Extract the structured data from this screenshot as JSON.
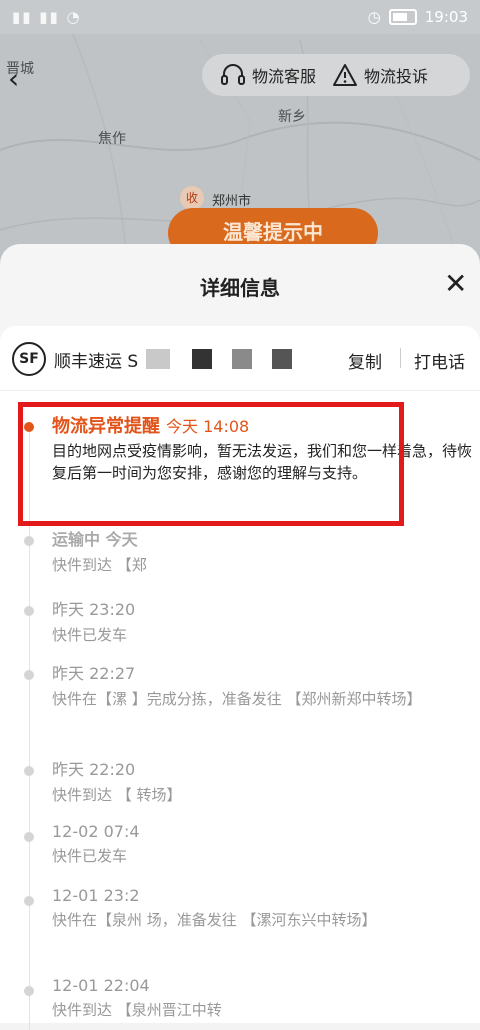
{
  "status_bar": {
    "left": "",
    "time": "19:03"
  },
  "map": {
    "cities": [
      "晋城",
      "焦作",
      "新乡",
      "郑州市"
    ],
    "receiver_badge": "收",
    "banner": "温馨提示中"
  },
  "top_actions": {
    "service": "物流客服",
    "complaint": "物流投诉"
  },
  "sheet": {
    "title": "详细信息",
    "close": "✕"
  },
  "carrier": {
    "logo": "SF",
    "name": "顺丰速运 S",
    "copy": "复制",
    "call": "打电话"
  },
  "alert": {
    "title": "物流异常提醒",
    "time": "今天 14:08",
    "desc": "目的地网点受疫情影响，暂无法发运，我们和您一样着急，待恢复后第一时间为您安排，感谢您的理解与支持。"
  },
  "events": [
    {
      "time": "运输中 今天",
      "desc": "快件到达 【郑"
    },
    {
      "time": "昨天 23:20",
      "desc": "快件已发车"
    },
    {
      "time": "昨天 22:27",
      "desc": "快件在【漯        】完成分拣，准备发往 【郑州新郑中转场】"
    },
    {
      "time": "昨天 22:20",
      "desc": "快件到达 【       转场】"
    },
    {
      "time": "12-02 07:4",
      "desc": "快件已发车"
    },
    {
      "time": "12-01 23:2",
      "desc": "快件在【泉州              场，准备发往 【漯河东兴中转场】"
    },
    {
      "time": "12-01 22:04",
      "desc": "快件到达 【泉州晋江中转"
    }
  ]
}
